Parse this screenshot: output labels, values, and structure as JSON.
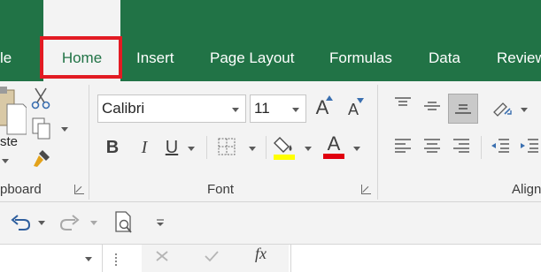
{
  "tabs": {
    "file": "le",
    "home": "Home",
    "insert": "Insert",
    "page_layout": "Page Layout",
    "formulas": "Formulas",
    "data": "Data",
    "review": "Review"
  },
  "clipboard": {
    "paste_label": "ste",
    "group_label": "pboard"
  },
  "font": {
    "font_name": "Calibri",
    "font_size": "11",
    "bold": "B",
    "italic": "I",
    "underline": "U",
    "font_color_glyph": "A",
    "grow_glyph": "A",
    "shrink_glyph": "A",
    "group_label": "Font",
    "highlight_color": "#ffff00",
    "font_color": "#e0000f"
  },
  "alignment": {
    "group_label": "Align"
  },
  "formula_bar": {
    "fx_label": "fx"
  },
  "colors": {
    "ribbon_green": "#217346",
    "active_tab_outline": "#e21b23"
  },
  "icons": [
    "cut-icon",
    "copy-icon",
    "format-painter-icon",
    "paste-icon",
    "borders-icon",
    "fill-color-icon",
    "undo-icon",
    "redo-icon",
    "print-preview-icon",
    "orientation-icon",
    "indent-icon"
  ]
}
